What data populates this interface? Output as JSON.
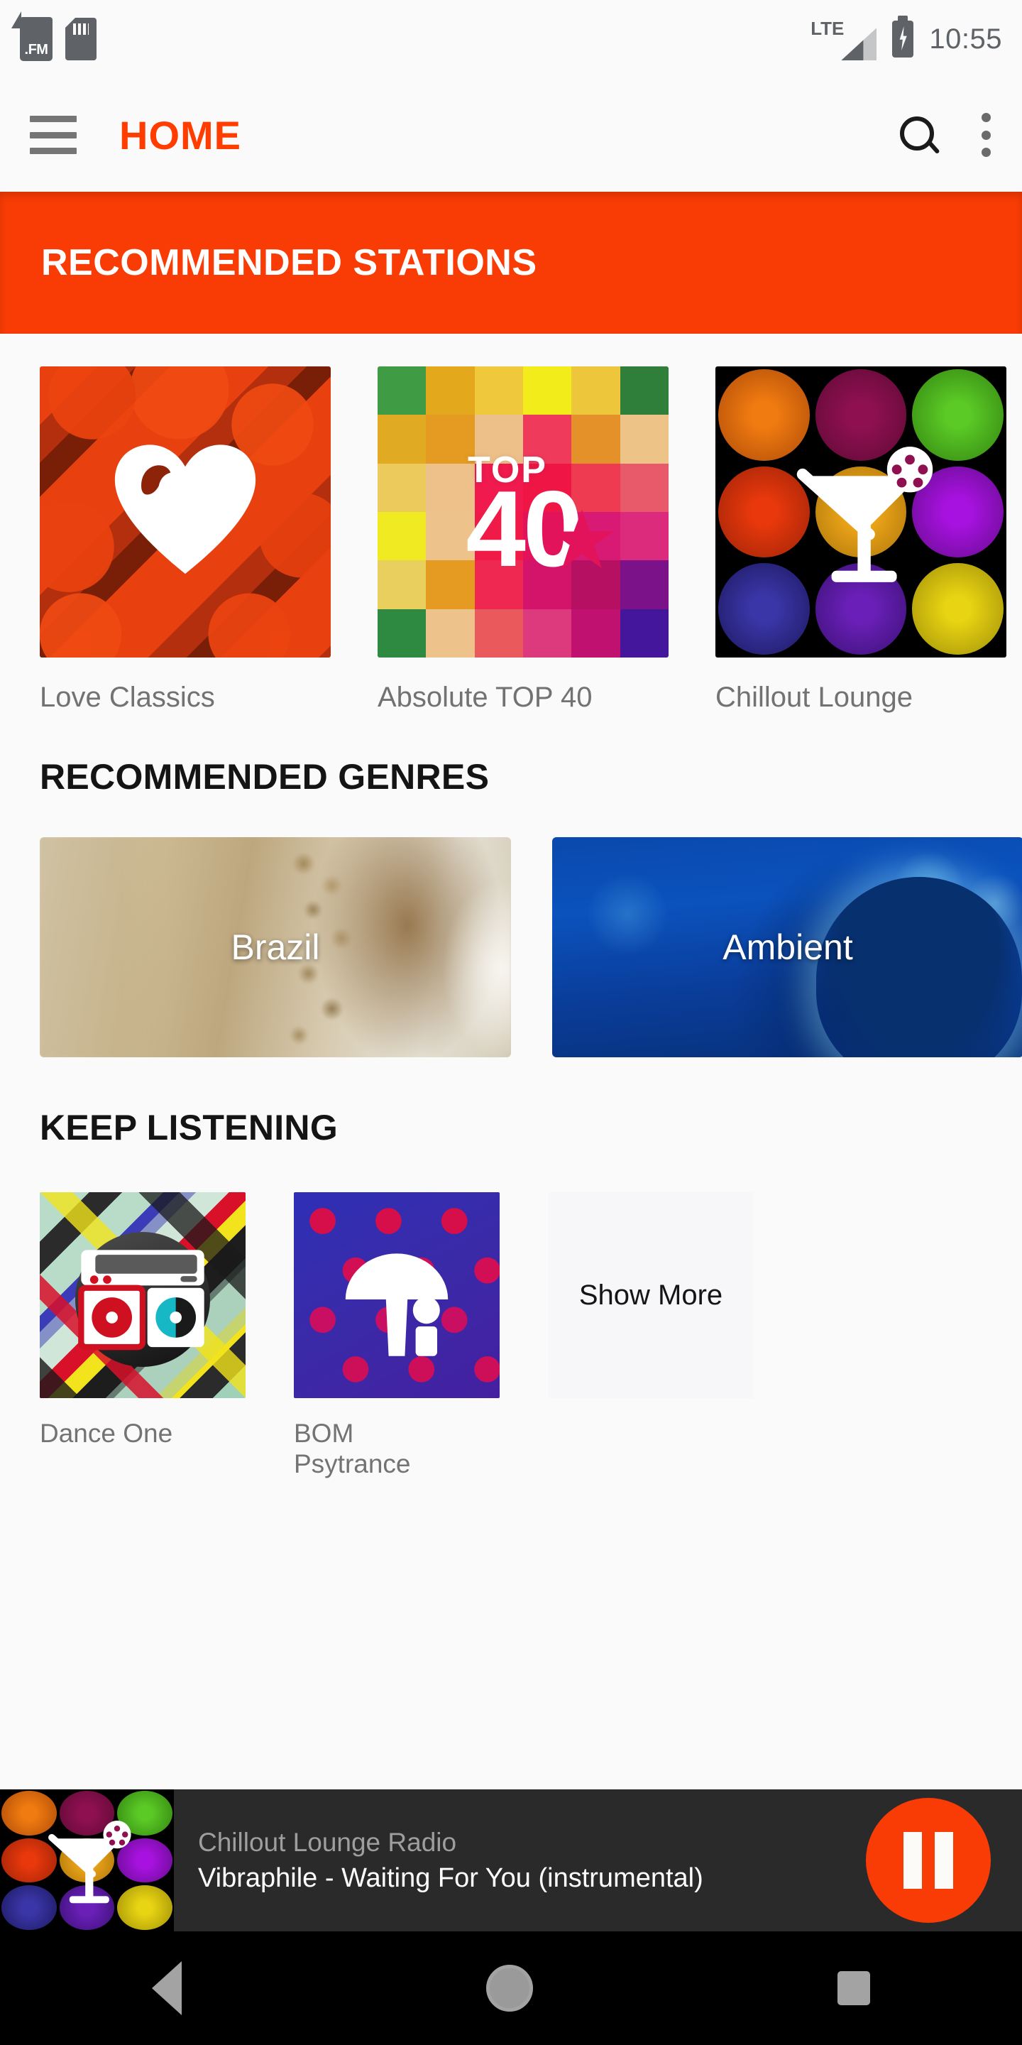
{
  "status_bar": {
    "notification_icons": [
      "fm-logo-icon",
      "sim-card-icon"
    ],
    "fm_logo_text": ".FM",
    "network_type": "LTE",
    "signal_icon": "signal-bars-icon",
    "battery_icon": "battery-charging-icon",
    "time": "10:55"
  },
  "app_bar": {
    "menu_icon": "hamburger-menu-icon",
    "title": "HOME",
    "search_icon": "search-icon",
    "overflow_icon": "overflow-menu-icon",
    "title_color": "#ff3d00"
  },
  "banner": {
    "title": "RECOMMENDED STATIONS",
    "background_color": "#f93c05"
  },
  "stations": [
    {
      "name": "Love Classics",
      "art": "heart-artwork"
    },
    {
      "name": "Absolute TOP 40",
      "art": "top40-artwork",
      "art_top_text": "TOP",
      "art_number": "40"
    },
    {
      "name": "Chillout Lounge",
      "art": "cocktail-artwork"
    }
  ],
  "genres_section": {
    "title": "RECOMMENDED GENRES",
    "cards": [
      {
        "label": "Brazil",
        "art": "percussion-photo"
      },
      {
        "label": "Ambient",
        "art": "blue-silhouette-photo"
      }
    ]
  },
  "keep_listening": {
    "title": "KEEP LISTENING",
    "items": [
      {
        "label": "Dance One",
        "art": "boombox-artwork"
      },
      {
        "label": "BOM\nPsytrance",
        "art": "mushroom-artwork"
      }
    ],
    "show_more_label": "Show More"
  },
  "now_playing": {
    "station": "Chillout Lounge Radio",
    "track": "Vibraphile - Waiting For You (instrumental)",
    "art": "cocktail-artwork",
    "button_icon": "pause-icon",
    "button_color": "#f93c05",
    "background_color": "#2b2a2a"
  },
  "nav_bar": {
    "back_icon": "back-triangle-icon",
    "home_icon": "home-circle-icon",
    "recents_icon": "recents-square-icon"
  },
  "palette": {
    "accent": "#f93c05",
    "page_background": "#fafafa",
    "label_gray": "#737373",
    "heading_black": "#141414"
  }
}
